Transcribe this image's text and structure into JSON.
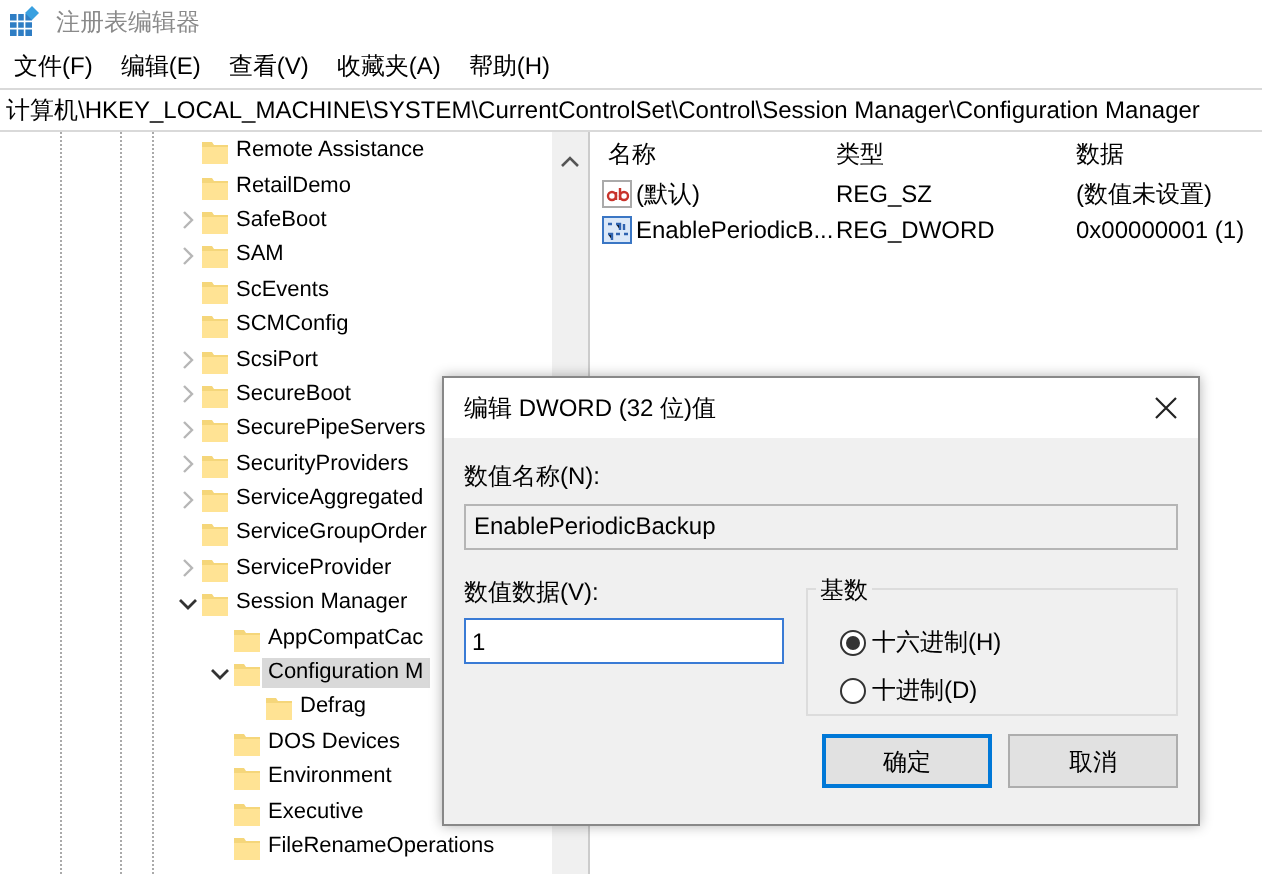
{
  "window": {
    "title": "注册表编辑器"
  },
  "menu": [
    "文件(F)",
    "编辑(E)",
    "查看(V)",
    "收藏夹(A)",
    "帮助(H)"
  ],
  "address": "计算机\\HKEY_LOCAL_MACHINE\\SYSTEM\\CurrentControlSet\\Control\\Session Manager\\Configuration Manager",
  "tree": {
    "items": [
      {
        "label": "Remote Assistance",
        "selected": false
      },
      {
        "label": "RetailDemo",
        "selected": false
      },
      {
        "label": "SafeBoot",
        "expanded": false,
        "selected": false
      },
      {
        "label": "SAM",
        "expanded": false,
        "selected": false
      },
      {
        "label": "ScEvents",
        "selected": false
      },
      {
        "label": "SCMConfig",
        "selected": false
      },
      {
        "label": "ScsiPort",
        "expanded": false,
        "selected": false
      },
      {
        "label": "SecureBoot",
        "expanded": false,
        "selected": false
      },
      {
        "label": "SecurePipeServers",
        "expanded": false,
        "selected": false
      },
      {
        "label": "SecurityProviders",
        "expanded": false,
        "selected": false
      },
      {
        "label": "ServiceAggregated",
        "expanded": false,
        "selected": false
      },
      {
        "label": "ServiceGroupOrder",
        "selected": false
      },
      {
        "label": "ServiceProvider",
        "expanded": false,
        "selected": false
      },
      {
        "label": "Session Manager",
        "expanded": true,
        "selected": false,
        "children": [
          {
            "label": "AppCompatCac",
            "selected": false
          },
          {
            "label": "Configuration M",
            "expanded": true,
            "selected": true,
            "children": [
              {
                "label": "Defrag",
                "selected": false
              }
            ]
          },
          {
            "label": "DOS Devices",
            "selected": false
          },
          {
            "label": "Environment",
            "selected": false
          },
          {
            "label": "Executive",
            "selected": false
          },
          {
            "label": "FileRenameOperations",
            "selected": false
          }
        ]
      }
    ]
  },
  "values": {
    "columns": [
      "名称",
      "类型",
      "数据"
    ],
    "rows": [
      {
        "kind": "string",
        "name": "(默认)",
        "type": "REG_SZ",
        "data": "(数值未设置)"
      },
      {
        "kind": "binary",
        "name": "EnablePeriodicB...",
        "type": "REG_DWORD",
        "data": "0x00000001 (1)"
      }
    ]
  },
  "dialog": {
    "title": "编辑 DWORD (32 位)值",
    "value_name": {
      "label": "数值名称(N):",
      "value": "EnablePeriodicBackup"
    },
    "value_data": {
      "label": "数值数据(V):",
      "value": "1"
    },
    "base": {
      "label": "基数",
      "options": [
        {
          "label": "十六进制(H)",
          "selected": true
        },
        {
          "label": "十进制(D)",
          "selected": false
        }
      ]
    },
    "buttons": [
      {
        "label": "确定",
        "default": true
      },
      {
        "label": "取消",
        "default": false
      }
    ]
  }
}
